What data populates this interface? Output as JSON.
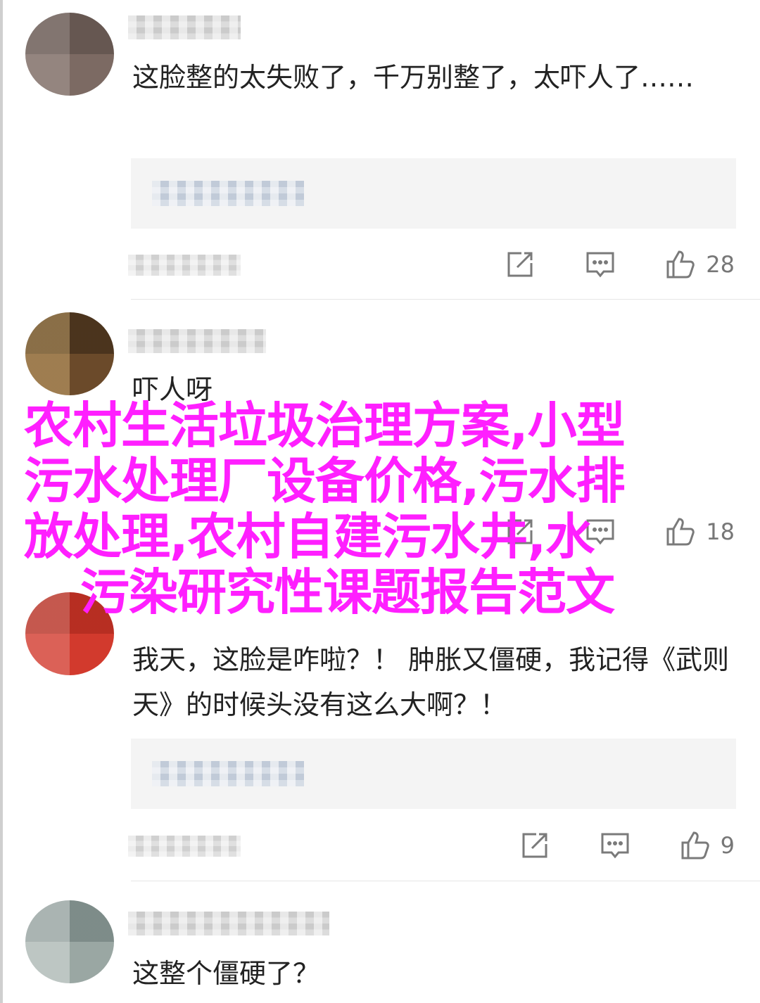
{
  "comments": [
    {
      "text": "这脸整的太失败了，千万别整了，太吓人了……",
      "like_count": "28"
    },
    {
      "text": "吓人呀",
      "like_count": "18"
    },
    {
      "text": "我天，这脸是咋啦？！ 肿胀又僵硬，我记得《武则天》的时候头没有这么大啊？！",
      "like_count": "9"
    },
    {
      "text": "这整个僵硬了？"
    }
  ],
  "overlay": {
    "line1": "农村生活垃圾治理方案,小型",
    "line2": "污水处理厂设备价格,污水排",
    "line3": "放处理,农村自建污水井,水",
    "line4": "污染研究性课题报告范文"
  },
  "icons": {
    "share": "share-icon",
    "reply": "reply-icon",
    "like": "thumb-up-icon"
  },
  "colors": {
    "overlay_text": "#ff1fff",
    "icon_gray": "#7a7a7a",
    "quote_bg": "#f4f4f4"
  }
}
